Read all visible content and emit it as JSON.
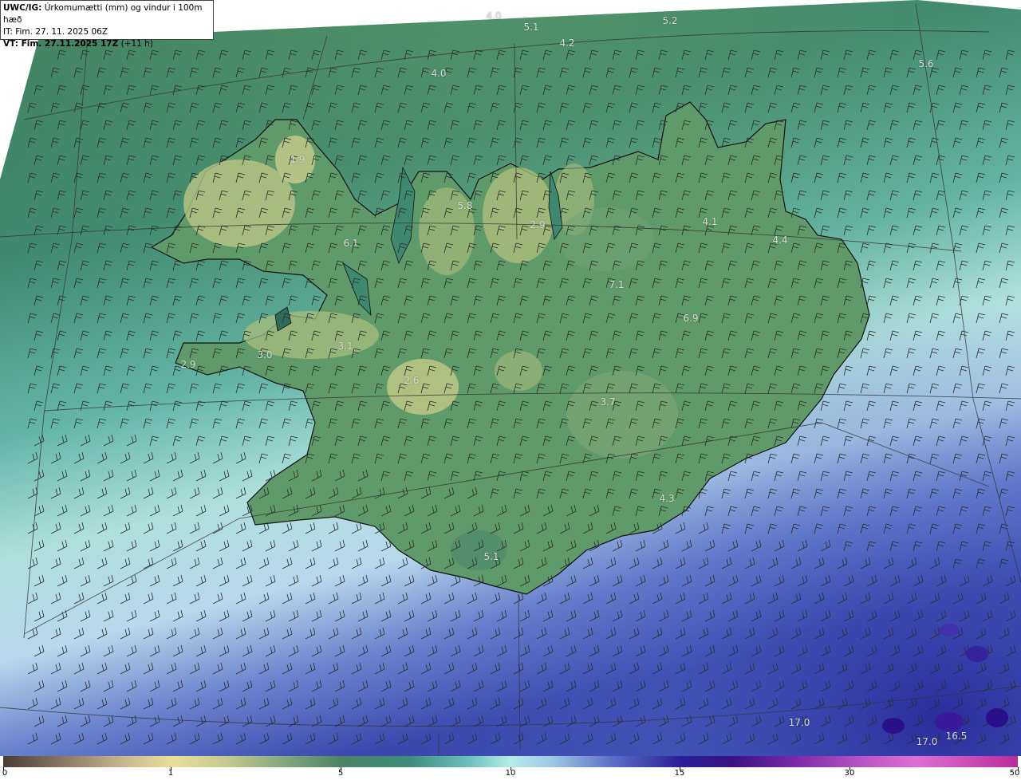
{
  "header": {
    "model": "UWC/IG:",
    "description": "Úrkomumætti (mm) og vindur i 100m hæð",
    "initial_time": "IT: Fim. 27. 11. 2025 06Z",
    "valid_prefix": "VT: Fim. 27.11.2025 17Z",
    "lead_time": "(+11 h)"
  },
  "map_labels": [
    "4.0",
    "5.1",
    "4.2",
    "5.2",
    "4.0",
    "5.6",
    "5.8",
    "2.9",
    "6.1",
    "4.1",
    "4.4",
    "7.1",
    "6.9",
    "3.0",
    "3.1",
    "2.9",
    "2.6",
    "3.7",
    "4.3",
    "5.1",
    "17.0",
    "17.0",
    "16.5",
    "1.9"
  ],
  "colorbar": {
    "ticks": [
      "0",
      "1",
      "5",
      "10",
      "15",
      "30",
      "50"
    ],
    "colors": [
      "#4b3c35",
      "#e9df9a",
      "#4c8466",
      "#b7ece8",
      "#2a1f9a",
      "#7a2aa6",
      "#b82c9a"
    ]
  }
}
